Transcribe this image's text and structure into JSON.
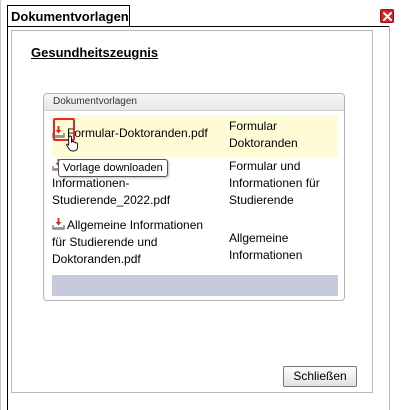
{
  "window": {
    "title": "Dokumentvorlagen",
    "close_icon": "close-x-icon",
    "close_color": "#d9232a"
  },
  "page": {
    "heading": "Gesundheitszeugnis"
  },
  "group": {
    "title": "Dokumentvorlagen",
    "rows": [
      {
        "name_lines": [
          "Formular-Doktoranden.pdf"
        ],
        "desc_lines": [
          "Formular",
          "Doktoranden"
        ],
        "icon": "download-icon",
        "highlighted": true
      },
      {
        "name_lines": [
          "Informationen-",
          "Studierende_2022.pdf"
        ],
        "desc_lines": [
          "Formular und",
          "Informationen für",
          "Studierende"
        ],
        "icon": "download-icon"
      },
      {
        "name_lines": [
          "Allgemeine Informationen",
          "für Studierende und",
          "Doktoranden.pdf"
        ],
        "desc_lines": [
          "Allgemeine",
          "Informationen"
        ],
        "icon": "download-icon"
      }
    ],
    "highlight_color": "#fefbd5",
    "empty_row_color": "#c7c9dd"
  },
  "tooltip": {
    "text": "Vorlage downloaden"
  },
  "footer": {
    "close_label": "Schließen"
  }
}
